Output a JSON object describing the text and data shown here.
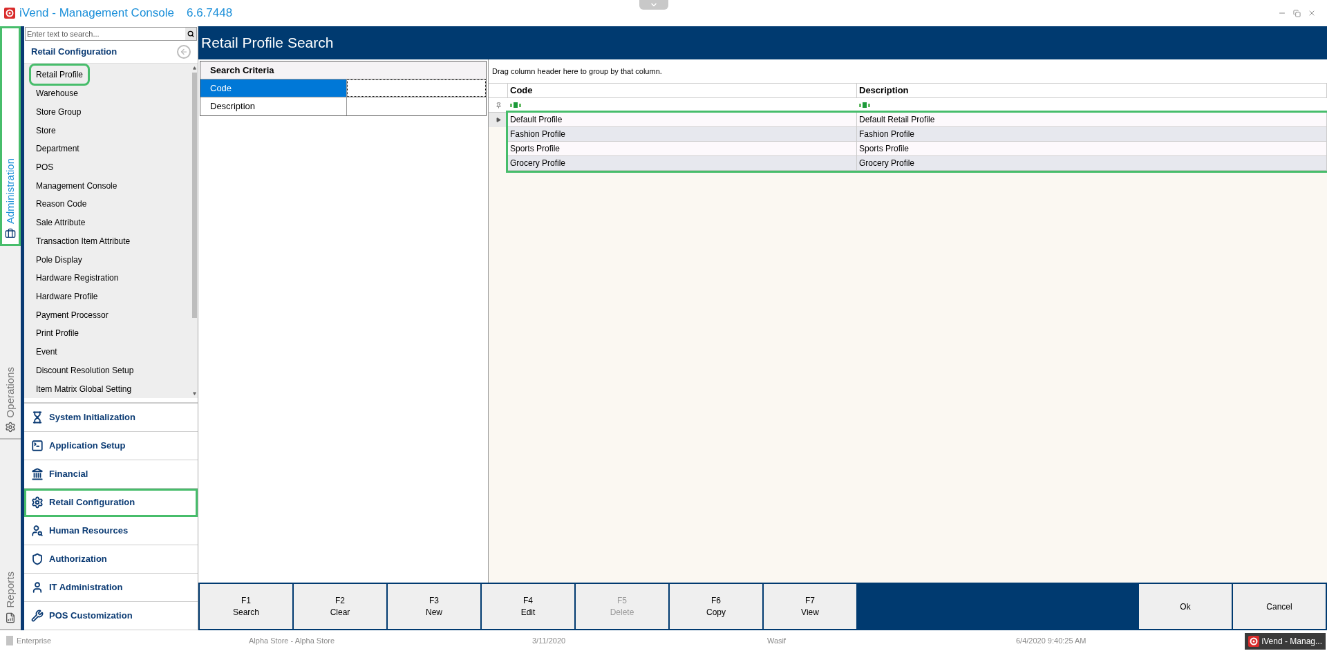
{
  "window": {
    "title": "iVend - Management Console",
    "version": "6.6.7448"
  },
  "side_tabs": [
    {
      "label": "Administration",
      "selected": true,
      "highlighted": true
    },
    {
      "label": "Operations",
      "selected": false,
      "highlighted": false
    },
    {
      "label": "Reports",
      "selected": false,
      "highlighted": false
    }
  ],
  "sidebar": {
    "search": {
      "placeholder": "Enter text to search..."
    },
    "heading": "Retail Configuration",
    "items": [
      {
        "label": "Retail Profile",
        "highlighted": true
      },
      {
        "label": "Warehouse",
        "highlighted": false
      },
      {
        "label": "Store Group",
        "highlighted": false
      },
      {
        "label": "Store",
        "highlighted": false
      },
      {
        "label": "Department",
        "highlighted": false
      },
      {
        "label": "POS",
        "highlighted": false
      },
      {
        "label": "Management Console",
        "highlighted": false
      },
      {
        "label": "Reason Code",
        "highlighted": false
      },
      {
        "label": "Sale Attribute",
        "highlighted": false
      },
      {
        "label": "Transaction Item Attribute",
        "highlighted": false
      },
      {
        "label": "Pole Display",
        "highlighted": false
      },
      {
        "label": "Hardware Registration",
        "highlighted": false
      },
      {
        "label": "Hardware Profile",
        "highlighted": false
      },
      {
        "label": "Payment Processor",
        "highlighted": false
      },
      {
        "label": "Print Profile",
        "highlighted": false
      },
      {
        "label": "Event",
        "highlighted": false
      },
      {
        "label": "Discount Resolution Setup",
        "highlighted": false
      },
      {
        "label": "Item Matrix Global Setting",
        "highlighted": false
      }
    ],
    "sections": [
      {
        "label": "System Initialization",
        "highlighted": false
      },
      {
        "label": "Application Setup",
        "highlighted": false
      },
      {
        "label": "Financial",
        "highlighted": false
      },
      {
        "label": "Retail Configuration",
        "highlighted": true
      },
      {
        "label": "Human Resources",
        "highlighted": false
      },
      {
        "label": "Authorization",
        "highlighted": false
      },
      {
        "label": "IT Administration",
        "highlighted": false
      },
      {
        "label": "POS Customization",
        "highlighted": false
      }
    ]
  },
  "page_title": "Retail Profile Search",
  "criteria": {
    "heading": "Search Criteria",
    "fields": [
      {
        "label": "Code",
        "selected": true
      },
      {
        "label": "Description",
        "selected": false
      }
    ]
  },
  "grid": {
    "group_hint": "Drag column header here to group by that column.",
    "columns": [
      "Code",
      "Description"
    ],
    "rows_highlighted": true,
    "rows": [
      {
        "cells": [
          "Default Profile",
          "Default Retail Profile"
        ],
        "current": true
      },
      {
        "cells": [
          "Fashion Profile",
          "Fashion Profile"
        ],
        "current": false
      },
      {
        "cells": [
          "Sports Profile",
          "Sports Profile"
        ],
        "current": false
      },
      {
        "cells": [
          "Grocery Profile",
          "Grocery Profile"
        ],
        "current": false
      }
    ]
  },
  "function_keys": [
    {
      "key": "F1",
      "label": "Search",
      "disabled": false
    },
    {
      "key": "F2",
      "label": "Clear",
      "disabled": false
    },
    {
      "key": "F3",
      "label": "New",
      "disabled": false
    },
    {
      "key": "F4",
      "label": "Edit",
      "disabled": false
    },
    {
      "key": "F5",
      "label": "Delete",
      "disabled": true
    },
    {
      "key": "F6",
      "label": "Copy",
      "disabled": false
    },
    {
      "key": "F7",
      "label": "View",
      "disabled": false
    }
  ],
  "dialog_buttons": [
    "Ok",
    "Cancel"
  ],
  "status_bar": {
    "edition": "Enterprise",
    "store": "Alpha Store - Alpha Store",
    "date": "3/11/2020",
    "user": "Wasif",
    "timestamp": "6/4/2020 9:40:25 AM",
    "task": "iVend - Manag..."
  }
}
